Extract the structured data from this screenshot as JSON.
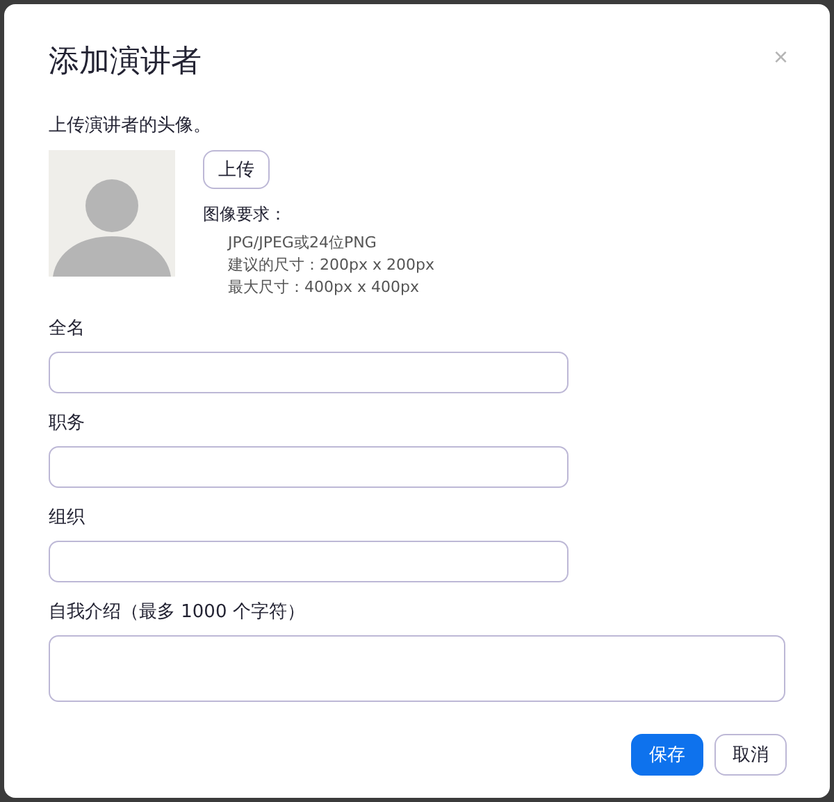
{
  "dialog": {
    "title": "添加演讲者",
    "close": "×"
  },
  "avatar": {
    "prompt": "上传演讲者的头像。",
    "upload": "上传",
    "requirements_title": "图像要求：",
    "requirements": [
      "JPG/JPEG或24位PNG",
      "建议的尺寸：200px x 200px",
      "最大尺寸：400px x 400px"
    ]
  },
  "fields": [
    {
      "label": "全名",
      "kind": "input"
    },
    {
      "label": "职务",
      "kind": "input"
    },
    {
      "label": "组织",
      "kind": "input"
    },
    {
      "label": "自我介绍（最多 1000 个字符）",
      "kind": "textarea"
    }
  ],
  "buttons": [
    {
      "label": "保存",
      "kind": "primary"
    },
    {
      "label": "取消",
      "kind": "secondary"
    }
  ]
}
